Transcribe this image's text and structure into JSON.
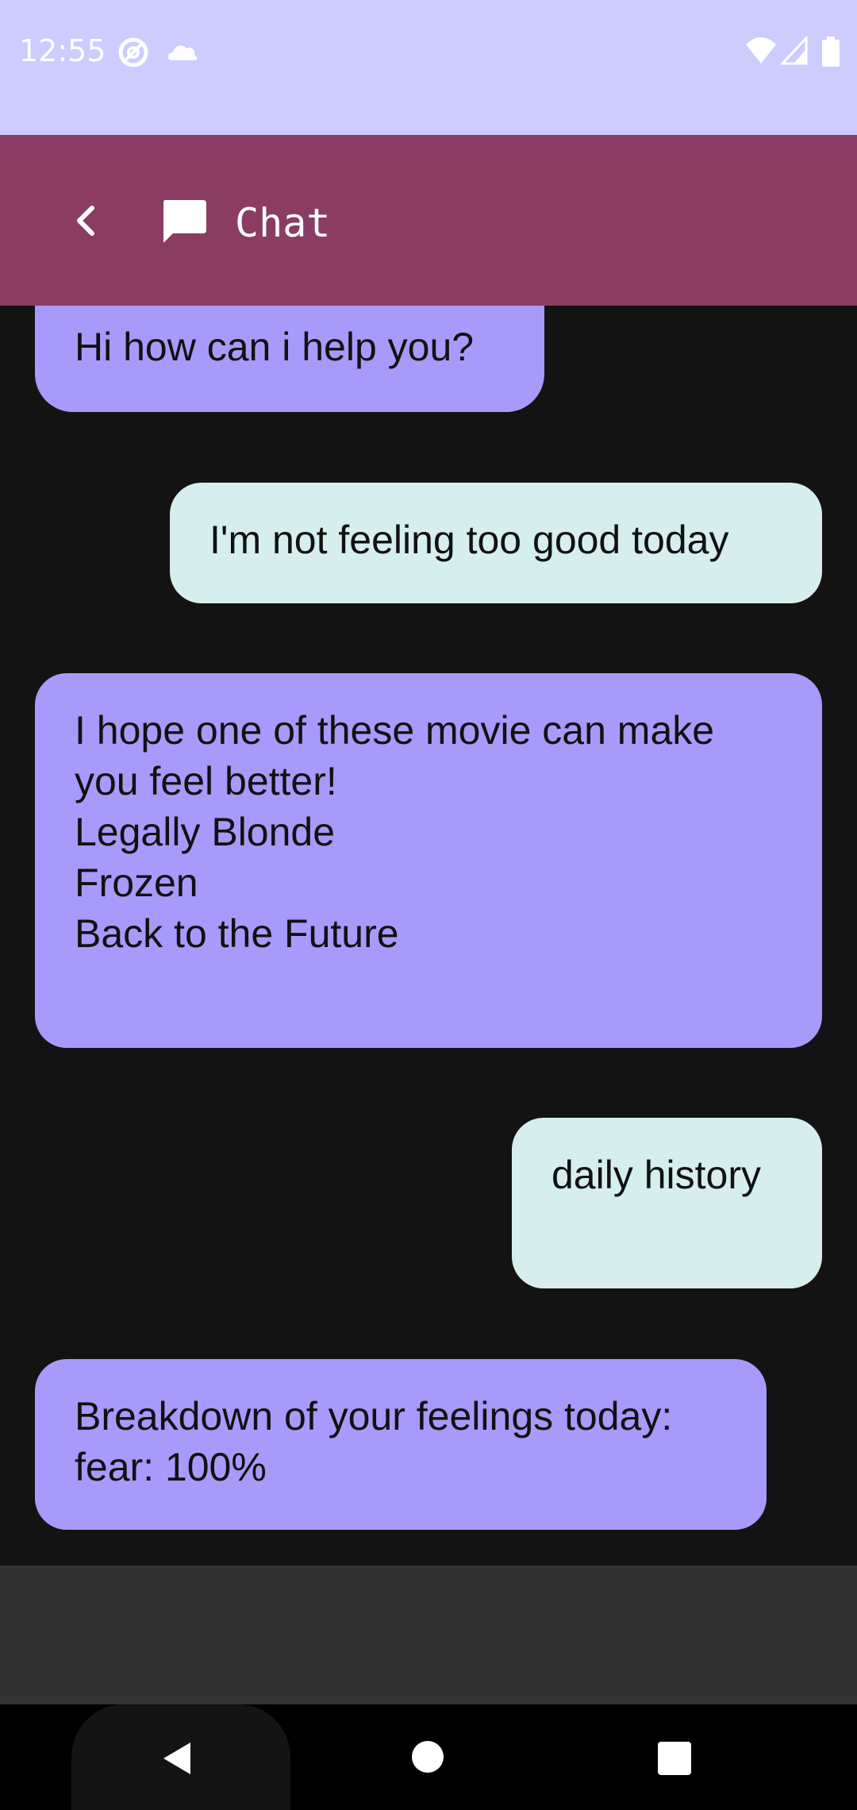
{
  "status_bar": {
    "time": "12:55",
    "icons": [
      "at-sign-icon",
      "cloud-icon",
      "wifi-icon",
      "signal-icon",
      "battery-icon"
    ]
  },
  "app_bar": {
    "title": "Chat",
    "icons": [
      "back-chevron-icon",
      "chat-bubble-icon"
    ],
    "background_color": "#8a3c63"
  },
  "messages": [
    {
      "sender": "bot",
      "text": "Hi how can i help you?"
    },
    {
      "sender": "user",
      "text": "I'm not feeling too good today"
    },
    {
      "sender": "bot",
      "text": "I hope one of these movie can make\nyou feel better!\nLegally Blonde\nFrozen\nBack to the Future"
    },
    {
      "sender": "user",
      "text": "daily history"
    },
    {
      "sender": "bot",
      "text": "Breakdown of your feelings today:\nfear: 100%"
    }
  ],
  "colors": {
    "status_bar": "#ccccff",
    "bot_bubble": "#a79afb",
    "user_bubble": "#d6eeee",
    "chat_background": "#131313",
    "input_bar": "#323232"
  },
  "nav_bar": {
    "icons": [
      "nav-back-icon",
      "nav-home-icon",
      "nav-recents-icon"
    ]
  }
}
